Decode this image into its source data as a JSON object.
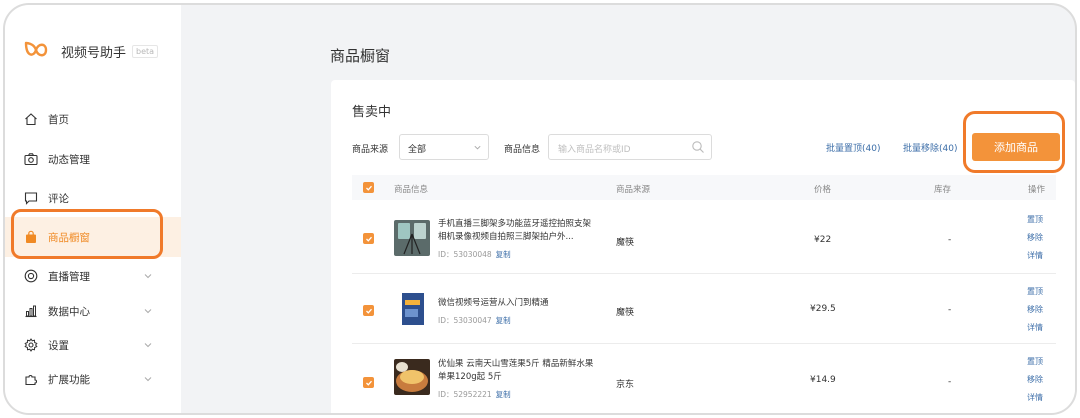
{
  "app": {
    "name": "视频号助手",
    "badge": "beta"
  },
  "sidebar": {
    "items": [
      {
        "label": "首页",
        "icon": "home-icon"
      },
      {
        "label": "动态管理",
        "icon": "camera-icon"
      },
      {
        "label": "评论",
        "icon": "comment-icon"
      },
      {
        "label": "商品橱窗",
        "icon": "shopping-bag-icon",
        "active": true
      },
      {
        "label": "直播管理",
        "icon": "live-icon",
        "expandable": true
      },
      {
        "label": "数据中心",
        "icon": "chart-icon",
        "expandable": true
      },
      {
        "label": "设置",
        "icon": "gear-icon",
        "expandable": true
      },
      {
        "label": "扩展功能",
        "icon": "extension-icon",
        "expandable": true
      }
    ]
  },
  "page": {
    "title": "商品橱窗"
  },
  "panel": {
    "section_title": "售卖中",
    "filters": {
      "source_label": "商品来源",
      "source_value": "全部",
      "info_label": "商品信息",
      "search_placeholder": "输入商品名称或ID"
    },
    "actions": {
      "batch_top": "批量置顶(40)",
      "batch_remove": "批量移除(40)",
      "add_product": "添加商品"
    },
    "columns": {
      "info": "商品信息",
      "source": "商品来源",
      "price": "价格",
      "stock": "库存",
      "ops": "操作"
    },
    "rows": [
      {
        "name": "手机直播三脚架多功能蓝牙遥控拍照支架相机录像视频自拍照三脚架拍户外...",
        "id": "ID：53030048",
        "copy": "复制",
        "source": "魔筷",
        "price": "¥22",
        "stock": "-",
        "ops": [
          "置顶",
          "移除",
          "详情"
        ]
      },
      {
        "name": "微信视频号运营从入门到精通",
        "id": "ID：53030047",
        "copy": "复制",
        "source": "魔筷",
        "price": "¥29.5",
        "stock": "-",
        "ops": [
          "置顶",
          "移除",
          "详情"
        ]
      },
      {
        "name": "优仙果 云南天山雪莲果5斤 精品新鲜水果单果120g起 5斤",
        "id": "ID：52952221",
        "copy": "复制",
        "source": "京东",
        "price": "¥14.9",
        "stock": "-",
        "ops": [
          "置顶",
          "移除",
          "详情"
        ]
      }
    ]
  },
  "colors": {
    "accent": "#f3933a",
    "highlight_ring": "#f07a2a",
    "link": "#3c6ea8"
  }
}
